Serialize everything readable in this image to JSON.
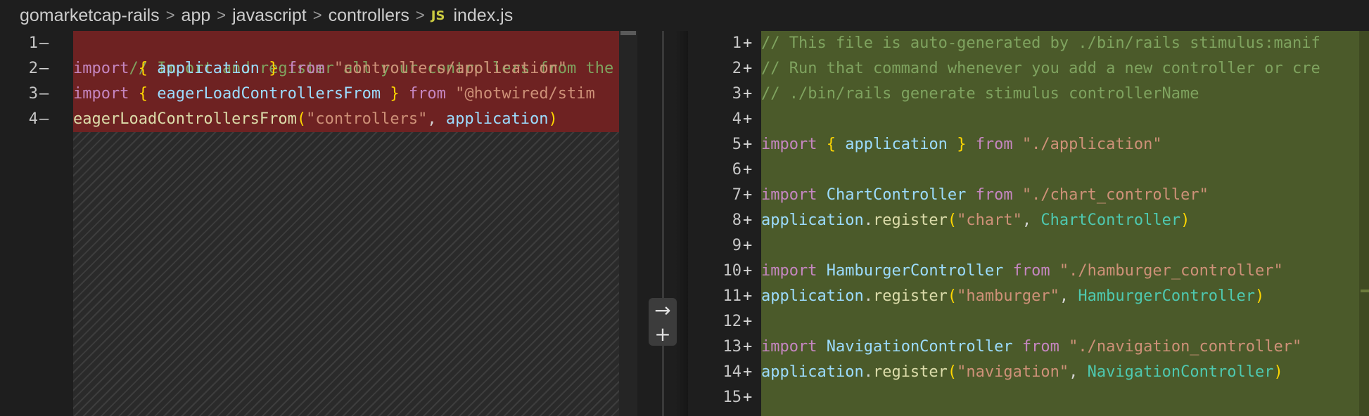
{
  "breadcrumb": {
    "items": [
      "gomarketcap-rails",
      "app",
      "javascript",
      "controllers"
    ],
    "file_badge": "JS",
    "file": "index.js",
    "separator": ">"
  },
  "left_pane": {
    "lines": [
      {
        "num": "1",
        "mark": "—"
      },
      {
        "num": "2",
        "mark": "—"
      },
      {
        "num": "3",
        "mark": "—"
      },
      {
        "num": "4",
        "mark": "—"
      }
    ],
    "code": {
      "l1": "// Import and register all your controllers from the imp",
      "l2_kw": "import",
      "l2_b1": "{",
      "l2_id": "application",
      "l2_b2": "}",
      "l2_from": "from",
      "l2_str": "\"controllers/application\"",
      "l3_kw": "import",
      "l3_b1": "{",
      "l3_id": "eagerLoadControllersFrom",
      "l3_b2": "}",
      "l3_from": "from",
      "l3_str": "\"@hotwired/stim",
      "l4_fn": "eagerLoadControllersFrom",
      "l4_p1": "(",
      "l4_str": "\"controllers\"",
      "l4_comma": ",",
      "l4_id": "application",
      "l4_p2": ")"
    }
  },
  "right_pane": {
    "lines": [
      {
        "num": "1",
        "mark": "+"
      },
      {
        "num": "2",
        "mark": "+"
      },
      {
        "num": "3",
        "mark": "+"
      },
      {
        "num": "4",
        "mark": "+"
      },
      {
        "num": "5",
        "mark": "+"
      },
      {
        "num": "6",
        "mark": "+"
      },
      {
        "num": "7",
        "mark": "+"
      },
      {
        "num": "8",
        "mark": "+"
      },
      {
        "num": "9",
        "mark": "+"
      },
      {
        "num": "10",
        "mark": "+"
      },
      {
        "num": "11",
        "mark": "+"
      },
      {
        "num": "12",
        "mark": "+"
      },
      {
        "num": "13",
        "mark": "+"
      },
      {
        "num": "14",
        "mark": "+"
      },
      {
        "num": "15",
        "mark": "+"
      }
    ],
    "code": {
      "l1": "// This file is auto-generated by ./bin/rails stimulus:manif",
      "l2": "// Run that command whenever you add a new controller or cre",
      "l3": "// ./bin/rails generate stimulus controllerName",
      "l5_kw": "import",
      "l5_b1": "{",
      "l5_id": "application",
      "l5_b2": "}",
      "l5_from": "from",
      "l5_str": "\"./application\"",
      "l7_kw": "import",
      "l7_id": "ChartController",
      "l7_from": "from",
      "l7_str": "\"./chart_controller\"",
      "l8_obj": "application",
      "l8_dot": ".",
      "l8_fn": "register",
      "l8_p1": "(",
      "l8_str": "\"chart\"",
      "l8_comma": ",",
      "l8_cls": "ChartController",
      "l8_p2": ")",
      "l10_kw": "import",
      "l10_id": "HamburgerController",
      "l10_from": "from",
      "l10_str": "\"./hamburger_controller\"",
      "l11_obj": "application",
      "l11_dot": ".",
      "l11_fn": "register",
      "l11_p1": "(",
      "l11_str": "\"hamburger\"",
      "l11_comma": ",",
      "l11_cls": "HamburgerController",
      "l11_p2": ")",
      "l13_kw": "import",
      "l13_id": "NavigationController",
      "l13_from": "from",
      "l13_str": "\"./navigation_controller\"",
      "l14_obj": "application",
      "l14_dot": ".",
      "l14_fn": "register",
      "l14_p1": "(",
      "l14_str": "\"navigation\"",
      "l14_comma": ",",
      "l14_cls": "NavigationController",
      "l14_p2": ")"
    }
  },
  "actions": {
    "apply_icon": "→",
    "add_icon": "+",
    "apply_icon_name": "arrow-right-icon",
    "add_icon_name": "plus-icon"
  },
  "colors": {
    "deleted_bg": "#6e2222",
    "added_bg": "#4b5a2a",
    "editor_bg": "#1e1e1e"
  }
}
